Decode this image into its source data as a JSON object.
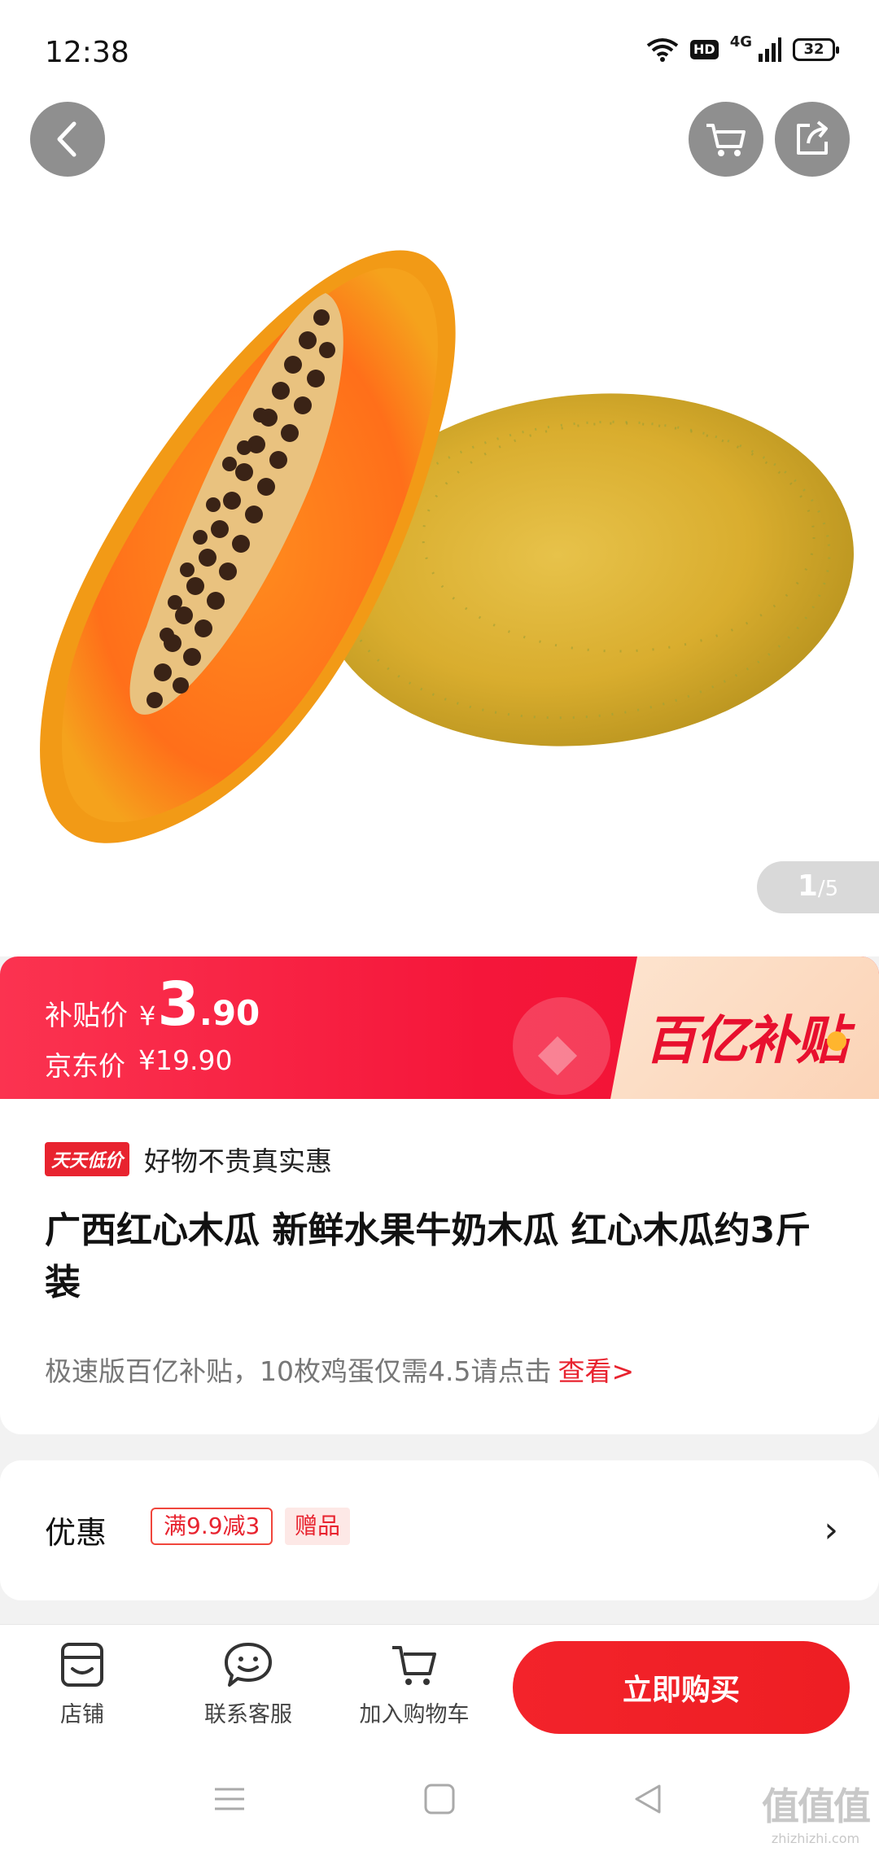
{
  "status_bar": {
    "time": "12:38",
    "hd": "HD",
    "network": "4G",
    "battery": "32"
  },
  "gallery": {
    "current": "1",
    "total": "/5"
  },
  "price": {
    "subsidy_label": "补贴价",
    "currency": "¥",
    "subsidy_int": "3",
    "subsidy_dec": ".90",
    "jd_label": "京东价",
    "jd_price": "¥19.90",
    "brand": "百亿补贴"
  },
  "product": {
    "badge": "天天低价",
    "slogan": "好物不贵真实惠",
    "title": "广西红心木瓜 新鲜水果牛奶木瓜 红心木瓜约3斤装",
    "promo_text": "极速版百亿补贴，10枚鸡蛋仅需4.5请点击",
    "promo_link": "查看>"
  },
  "discount": {
    "title": "优惠",
    "coupon": "满9.9减3",
    "gift": "赠品",
    "chevron": "›"
  },
  "actions": {
    "store": "店铺",
    "service": "联系客服",
    "add_cart": "加入购物车",
    "buy_now": "立即购买"
  },
  "watermark": {
    "main": "值值值",
    "sub": "zhizhizhi.com"
  },
  "colors": {
    "accent": "#F0182F",
    "buy_button": "#F02228",
    "banner_brand": "#FBD8BD"
  }
}
